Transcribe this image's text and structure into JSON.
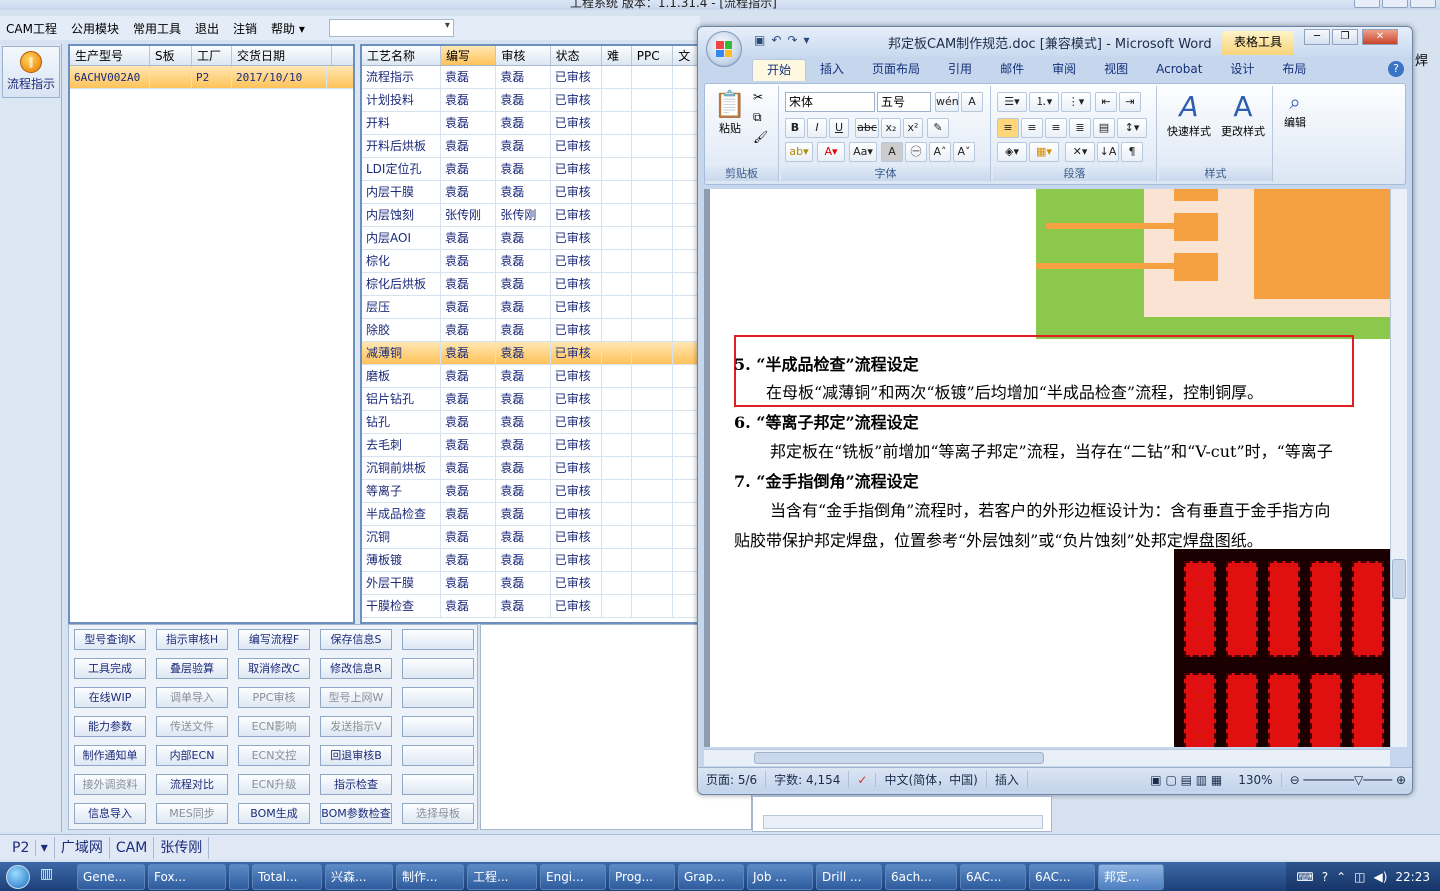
{
  "app": {
    "title": "工程系统   版本：1.1.31.4 - [流程指示]",
    "menu": [
      "CAM工程",
      "公用模块",
      "常用工具",
      "退出",
      "注销",
      "帮助"
    ],
    "combo_value": ""
  },
  "leftnav": {
    "button_label": "流程指示"
  },
  "orders": {
    "columns": [
      "生产型号",
      "S板",
      "工厂",
      "交货日期"
    ],
    "rows": [
      {
        "model": "6ACHV002A0",
        "sboard": "",
        "factory": "P2",
        "date": "2017/10/10"
      }
    ]
  },
  "process": {
    "columns": [
      "工艺名称",
      "编写",
      "审核",
      "状态",
      "难",
      "PPC",
      "文"
    ],
    "rows": [
      {
        "name": "流程指示",
        "writer": "袁磊",
        "reviewer": "袁磊",
        "status": "已审核"
      },
      {
        "name": "计划投料",
        "writer": "袁磊",
        "reviewer": "袁磊",
        "status": "已审核"
      },
      {
        "name": "开料",
        "writer": "袁磊",
        "reviewer": "袁磊",
        "status": "已审核"
      },
      {
        "name": "开料后烘板",
        "writer": "袁磊",
        "reviewer": "袁磊",
        "status": "已审核"
      },
      {
        "name": "LDI定位孔",
        "writer": "袁磊",
        "reviewer": "袁磊",
        "status": "已审核"
      },
      {
        "name": "内层干膜",
        "writer": "袁磊",
        "reviewer": "袁磊",
        "status": "已审核"
      },
      {
        "name": "内层蚀刻",
        "writer": "张传刚",
        "reviewer": "张传刚",
        "status": "已审核"
      },
      {
        "name": "内层AOI",
        "writer": "袁磊",
        "reviewer": "袁磊",
        "status": "已审核"
      },
      {
        "name": "棕化",
        "writer": "袁磊",
        "reviewer": "袁磊",
        "status": "已审核"
      },
      {
        "name": "棕化后烘板",
        "writer": "袁磊",
        "reviewer": "袁磊",
        "status": "已审核"
      },
      {
        "name": "层压",
        "writer": "袁磊",
        "reviewer": "袁磊",
        "status": "已审核"
      },
      {
        "name": "除胶",
        "writer": "袁磊",
        "reviewer": "袁磊",
        "status": "已审核"
      },
      {
        "name": "减薄铜",
        "writer": "袁磊",
        "reviewer": "袁磊",
        "status": "已审核"
      },
      {
        "name": "磨板",
        "writer": "袁磊",
        "reviewer": "袁磊",
        "status": "已审核"
      },
      {
        "name": "铝片钻孔",
        "writer": "袁磊",
        "reviewer": "袁磊",
        "status": "已审核"
      },
      {
        "name": "钻孔",
        "writer": "袁磊",
        "reviewer": "袁磊",
        "status": "已审核"
      },
      {
        "name": "去毛刺",
        "writer": "袁磊",
        "reviewer": "袁磊",
        "status": "已审核"
      },
      {
        "name": "沉铜前烘板",
        "writer": "袁磊",
        "reviewer": "袁磊",
        "status": "已审核"
      },
      {
        "name": "等离子",
        "writer": "袁磊",
        "reviewer": "袁磊",
        "status": "已审核"
      },
      {
        "name": "半成品检查",
        "writer": "袁磊",
        "reviewer": "袁磊",
        "status": "已审核"
      },
      {
        "name": "沉铜",
        "writer": "袁磊",
        "reviewer": "袁磊",
        "status": "已审核"
      },
      {
        "name": "薄板镀",
        "writer": "袁磊",
        "reviewer": "袁磊",
        "status": "已审核"
      },
      {
        "name": "外层干膜",
        "writer": "袁磊",
        "reviewer": "袁磊",
        "status": "已审核"
      },
      {
        "name": "干膜检查",
        "writer": "袁磊",
        "reviewer": "袁磊",
        "status": "已审核"
      }
    ]
  },
  "buttons": [
    {
      "label": "型号查询K",
      "enabled": true
    },
    {
      "label": "指示审核H",
      "enabled": true
    },
    {
      "label": "编写流程F",
      "enabled": true
    },
    {
      "label": "保存信息S",
      "enabled": true
    },
    {
      "label": "",
      "enabled": true
    },
    {
      "label": "工具完成",
      "enabled": true
    },
    {
      "label": "叠层验算",
      "enabled": true
    },
    {
      "label": "取消修改C",
      "enabled": true
    },
    {
      "label": "修改信息R",
      "enabled": true
    },
    {
      "label": "",
      "enabled": true
    },
    {
      "label": "在线WIP",
      "enabled": true
    },
    {
      "label": "调单导入",
      "enabled": false
    },
    {
      "label": "PPC审核",
      "enabled": false
    },
    {
      "label": "型号上网W",
      "enabled": false
    },
    {
      "label": "",
      "enabled": true
    },
    {
      "label": "能力参数",
      "enabled": true
    },
    {
      "label": "传送文件",
      "enabled": false
    },
    {
      "label": "ECN影响",
      "enabled": false
    },
    {
      "label": "发送指示V",
      "enabled": false
    },
    {
      "label": "",
      "enabled": true
    },
    {
      "label": "制作通知单",
      "enabled": true
    },
    {
      "label": "内部ECN",
      "enabled": true
    },
    {
      "label": "ECN文控",
      "enabled": false
    },
    {
      "label": "回退审核B",
      "enabled": true
    },
    {
      "label": "",
      "enabled": true
    },
    {
      "label": "接外调资料",
      "enabled": false
    },
    {
      "label": "流程对比",
      "enabled": true
    },
    {
      "label": "ECN升级",
      "enabled": false
    },
    {
      "label": "指示检查",
      "enabled": true
    },
    {
      "label": "",
      "enabled": true
    },
    {
      "label": "信息导入",
      "enabled": true
    },
    {
      "label": "MES同步",
      "enabled": false
    },
    {
      "label": "BOM生成",
      "enabled": true
    },
    {
      "label": "BOM参数检查",
      "enabled": true
    },
    {
      "label": "选择母板",
      "enabled": false
    }
  ],
  "statusbar": {
    "site": "P2",
    "network": "广域网",
    "module": "CAM",
    "user": "张传刚"
  },
  "right_edge_text": "焊",
  "word": {
    "title": "邦定板CAM制作规范.doc [兼容模式] - Microsoft Word",
    "context_tab": "表格工具",
    "tabs": [
      "开始",
      "插入",
      "页面布局",
      "引用",
      "邮件",
      "审阅",
      "视图",
      "Acrobat",
      "设计",
      "布局"
    ],
    "font_name": "宋体",
    "font_size": "五号",
    "groups": [
      "剪贴板",
      "字体",
      "段落",
      "样式",
      "编辑"
    ],
    "paste_label": "粘贴",
    "quick_style": "快速样式",
    "change_style": "更改样式",
    "edit_label": "编辑",
    "doc": {
      "h5": "5.  “半成品检查”流程设定",
      "p5": "在母板“减薄铜”和两次“板镀”后均增加“半成品检查”流程，控制铜厚。",
      "h6": "6.  “等离子邦定”流程设定",
      "p6": "邦定板在“铣板”前增加“等离子邦定”流程，当存在“二钻”和“V-cut”时，“等离子",
      "h7": "7.  “金手指倒角”流程设定",
      "p7a": "当含有“金手指倒角”流程时，若客户的外形边框设计为：含有垂直于金手指方向",
      "p7b": "贴胶带保护邦定焊盘，位置参考“外层蚀刻”或“负片蚀刻”处邦定焊盘图纸。"
    },
    "status": {
      "page": "页面: 5/6",
      "words": "字数: 4,154",
      "lang": "中文(简体，中国)",
      "mode": "插入",
      "zoom": "130%"
    }
  },
  "taskbar": {
    "items": [
      "Gene...",
      "Fox...",
      "",
      "Total...",
      "兴森...",
      "制作...",
      "工程...",
      "Engi...",
      "Prog...",
      "Grap...",
      "Job ...",
      "Drill ...",
      "6ach...",
      "6AC...",
      "6AC...",
      "邦定..."
    ],
    "clock": "22:23"
  },
  "colors": {
    "accent_orange": "#f5a142",
    "highlight_red": "#e02020",
    "selection": "#ffc25a"
  }
}
